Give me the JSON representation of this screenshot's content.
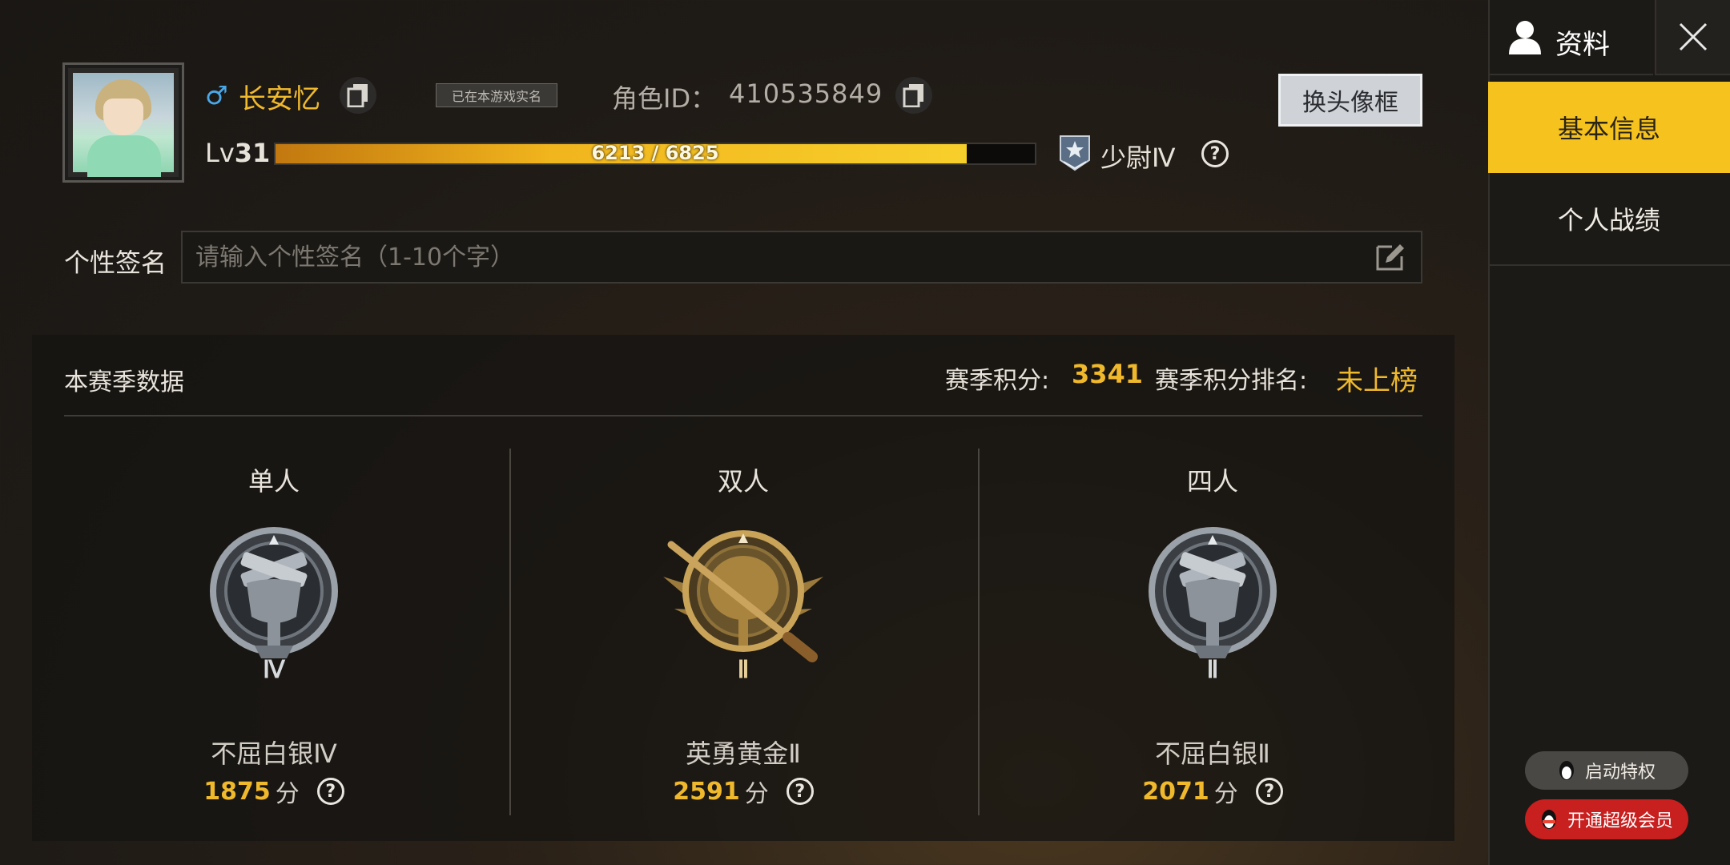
{
  "profile": {
    "gender_symbol": "♂",
    "name": "长安忆",
    "verified_badge": "已在本游戏实名",
    "role_id_label": "角色ID：",
    "role_id": "410535849",
    "change_frame_label": "换头像框",
    "level_prefix": "Lv",
    "level": "31",
    "xp_text": "6213 / 6825",
    "xp_fraction": 0.91,
    "military_rank": "少尉Ⅳ"
  },
  "signature": {
    "label": "个性签名",
    "placeholder": "请输入个性签名（1-10个字）"
  },
  "season": {
    "title": "本赛季数据",
    "points_label": "赛季积分:",
    "points_value": "3341",
    "rank_label": "赛季积分排名:",
    "rank_value": "未上榜",
    "modes": [
      {
        "title": "单人",
        "tier": "不屈白银Ⅳ",
        "tier_numeral": "Ⅳ",
        "score": "1875",
        "unit": "分"
      },
      {
        "title": "双人",
        "tier": "英勇黄金Ⅱ",
        "tier_numeral": "Ⅱ",
        "score": "2591",
        "unit": "分"
      },
      {
        "title": "四人",
        "tier": "不屈白银Ⅱ",
        "tier_numeral": "Ⅱ",
        "score": "2071",
        "unit": "分"
      }
    ]
  },
  "sidebar": {
    "title": "资料",
    "tabs": [
      {
        "label": "基本信息",
        "active": true
      },
      {
        "label": "个人战绩",
        "active": false
      }
    ],
    "privilege_label": "启动特权",
    "vip_label": "开通超级会员"
  },
  "colors": {
    "accent_gold": "#f0b92c",
    "active_tab": "#f6c21d",
    "gender_blue": "#4aa8e8",
    "vip_red": "#c81f1f"
  },
  "icons": [
    "copy-icon",
    "help-icon",
    "edit-icon",
    "user-icon",
    "close-icon",
    "rank-chevron-icon",
    "qq-penguin-icon"
  ]
}
